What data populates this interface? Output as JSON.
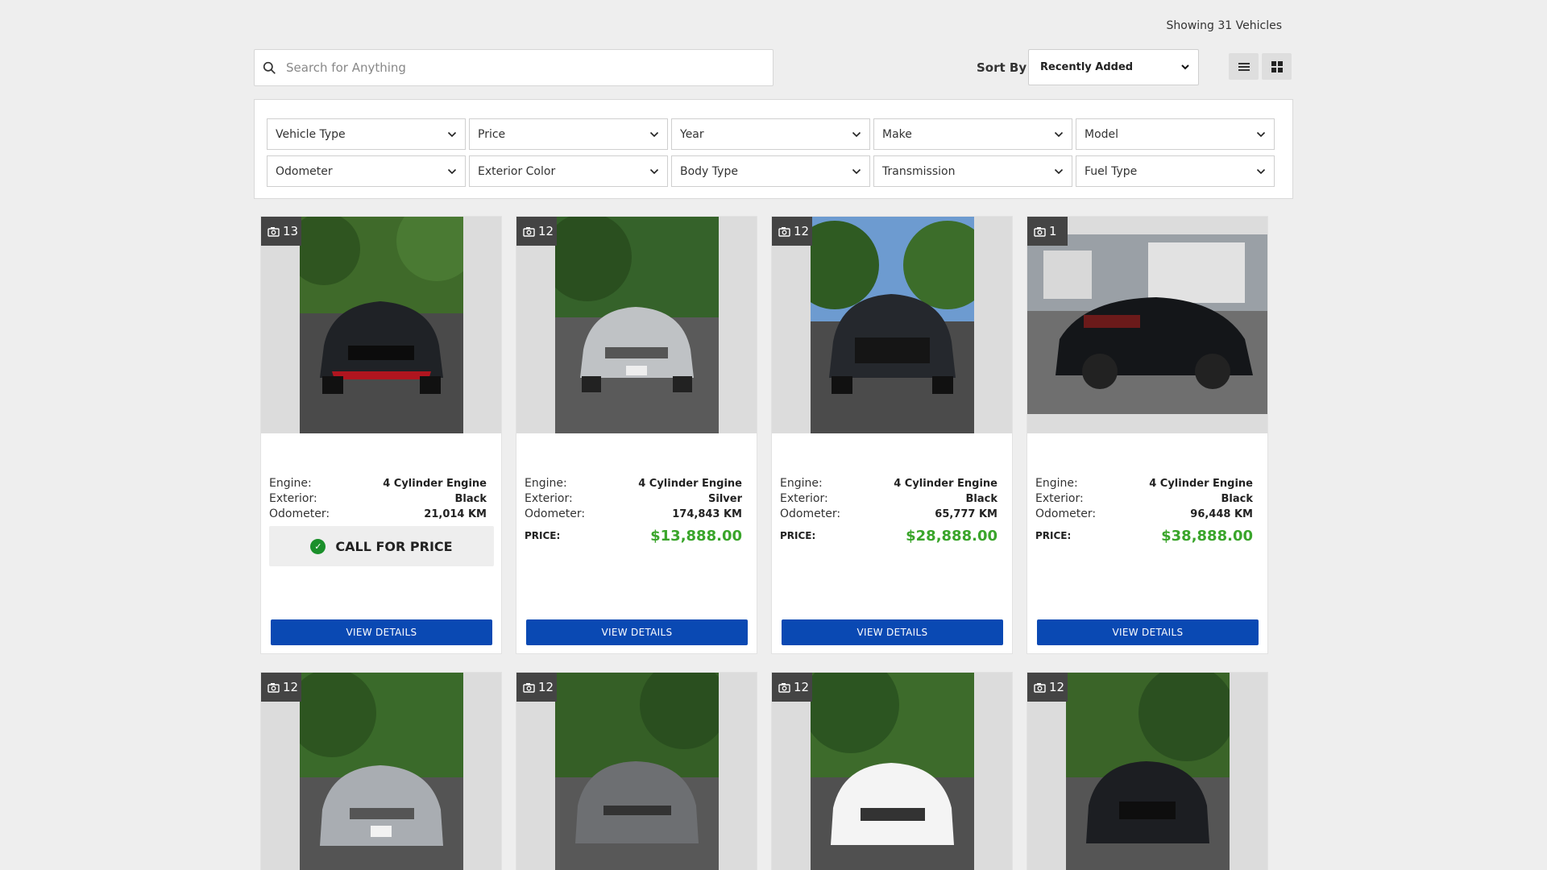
{
  "header": {
    "showing": "Showing 31 Vehicles"
  },
  "search": {
    "placeholder": "Search for Anything",
    "icon": "search-icon"
  },
  "sort": {
    "label": "Sort By",
    "selected": "Recently Added"
  },
  "view_toggle": {
    "list_icon": "list-view-icon",
    "grid_icon": "grid-view-icon"
  },
  "filters": [
    "Vehicle Type",
    "Price",
    "Year",
    "Make",
    "Model",
    "Odometer",
    "Exterior Color",
    "Body Type",
    "Transmission",
    "Fuel Type"
  ],
  "labels": {
    "engine": "Engine:",
    "exterior": "Exterior:",
    "odometer": "Odometer:",
    "price": "PRICE:",
    "call": "CALL FOR PRICE",
    "view": "VIEW DETAILS"
  },
  "colors": {
    "accent": "#0a49b3",
    "price": "#3aa52b",
    "badge": "#444444"
  },
  "vehicles": [
    {
      "photos": "13",
      "engine": "4 Cylinder Engine",
      "exterior": "Black",
      "odometer": "21,014 KM",
      "price": "",
      "call_for_price": true
    },
    {
      "photos": "12",
      "engine": "4 Cylinder Engine",
      "exterior": "Silver",
      "odometer": "174,843 KM",
      "price": "$13,888.00"
    },
    {
      "photos": "12",
      "engine": "4 Cylinder Engine",
      "exterior": "Black",
      "odometer": "65,777 KM",
      "price": "$28,888.00"
    },
    {
      "photos": "1",
      "engine": "4 Cylinder Engine",
      "exterior": "Black",
      "odometer": "96,448 KM",
      "price": "$38,888.00"
    },
    {
      "photos": "12"
    },
    {
      "photos": "12"
    },
    {
      "photos": "12"
    },
    {
      "photos": "12"
    }
  ]
}
